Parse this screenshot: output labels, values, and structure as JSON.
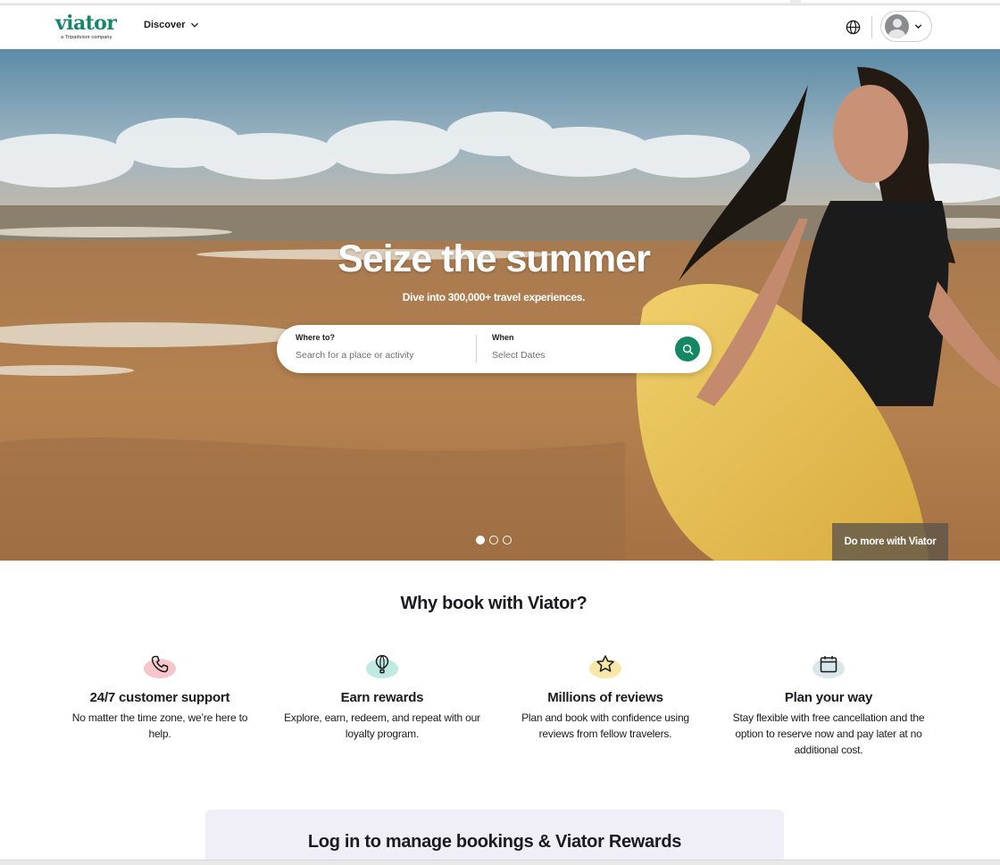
{
  "header": {
    "logo_text": "viator",
    "logo_subtext": "a Tripadvisor company",
    "discover_label": "Discover"
  },
  "hero": {
    "title": "Seize the summer",
    "subtitle": "Dive into 300,000+ travel experiences.",
    "search": {
      "where_label": "Where to?",
      "where_placeholder": "Search for a place or activity",
      "when_label": "When",
      "when_placeholder": "Select Dates"
    },
    "carousel": {
      "total": 3,
      "active": 1
    },
    "do_more_label": "Do more with Viator"
  },
  "why": {
    "title": "Why book with Viator?",
    "features": [
      {
        "icon": "phone-icon",
        "title": "24/7 customer support",
        "text": "No matter the time zone, we’re here to help.",
        "blob_color": "#f7c5cc"
      },
      {
        "icon": "balloon-icon",
        "title": "Earn rewards",
        "text": "Explore, earn, redeem, and repeat with our loyalty program.",
        "blob_color": "#bfe9e1"
      },
      {
        "icon": "star-icon",
        "title": "Millions of reviews",
        "text": "Plan and book with confidence using reviews from fellow travelers.",
        "blob_color": "#f8e7a8"
      },
      {
        "icon": "calendar-icon",
        "title": "Plan your way",
        "text": "Stay flexible with free cancellation and the option to reserve now and pay later at no additional cost.",
        "blob_color": "#d9e7ea"
      }
    ]
  },
  "login_panel": {
    "title": "Log in to manage bookings & Viator Rewards"
  },
  "colors": {
    "brand": "#14876a",
    "search_button": "#148763"
  }
}
